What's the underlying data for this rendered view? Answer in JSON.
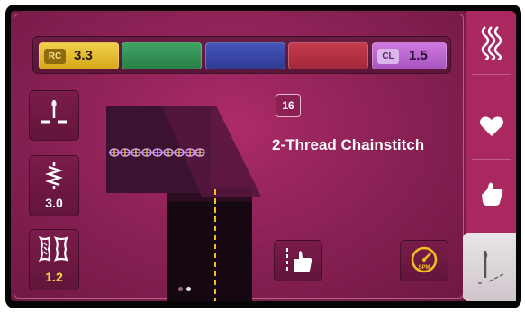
{
  "tension": {
    "rc_label": "RC",
    "rc_value": "3.3",
    "cl_label": "CL",
    "cl_value": "1.5",
    "colors": {
      "rc": "#e2bb30",
      "green": "#34925a",
      "blue": "#3a48a6",
      "red": "#b23142",
      "cl": "#bb66cf"
    }
  },
  "left_panel": {
    "needle_icon": "needle-position-icon",
    "stitch_length_icon": "stitch-length-icon",
    "stitch_length_value": "3.0",
    "diff_feed_icon": "differential-feed-icon",
    "diff_feed_value": "1.2"
  },
  "stitch": {
    "number": "16",
    "name": "2-Thread Chainstitch"
  },
  "pager": {
    "pages": 2,
    "current": 1
  },
  "buttons": {
    "guide_icon": "seam-guide-hand-icon",
    "speed_icon": "speed-gauge-icon",
    "speed_text": "SPM"
  },
  "sidebar": {
    "tabs": [
      {
        "icon": "stitch-menu-icon"
      },
      {
        "icon": "favorites-heart-icon"
      },
      {
        "icon": "hand-tutorial-icon"
      },
      {
        "icon": "stitch-view-icon",
        "active": true
      }
    ]
  }
}
